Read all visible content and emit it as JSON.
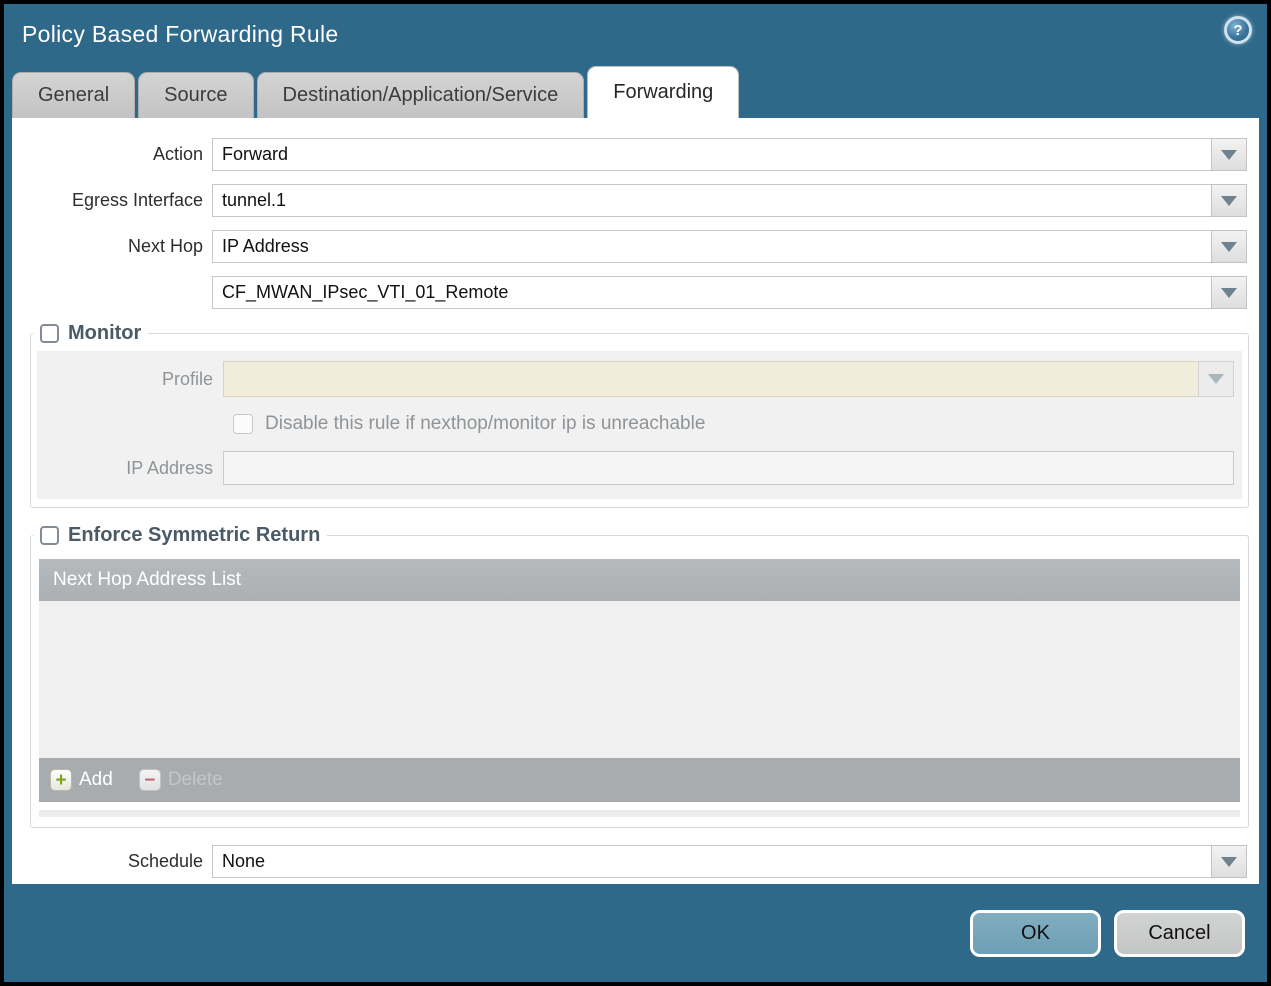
{
  "titlebar": {
    "title": "Policy Based Forwarding Rule"
  },
  "tabs": [
    {
      "label": "General",
      "active": false
    },
    {
      "label": "Source",
      "active": false
    },
    {
      "label": "Destination/Application/Service",
      "active": false
    },
    {
      "label": "Forwarding",
      "active": true
    }
  ],
  "form": {
    "action": {
      "label": "Action",
      "value": "Forward"
    },
    "egress_interface": {
      "label": "Egress Interface",
      "value": "tunnel.1"
    },
    "next_hop": {
      "label": "Next Hop",
      "value": "IP Address"
    },
    "next_hop_address": {
      "value": "CF_MWAN_IPsec_VTI_01_Remote"
    },
    "schedule": {
      "label": "Schedule",
      "value": "None"
    }
  },
  "monitor": {
    "title": "Monitor",
    "checked": false,
    "profile": {
      "label": "Profile",
      "value": ""
    },
    "disable_rule_label": "Disable this rule if nexthop/monitor ip is unreachable",
    "disable_rule_checked": false,
    "ip_address": {
      "label": "IP Address",
      "value": ""
    }
  },
  "enforce": {
    "title": "Enforce Symmetric Return",
    "checked": false,
    "table_header": "Next Hop Address List",
    "rows": [],
    "add_label": "Add",
    "delete_label": "Delete"
  },
  "help_icon": "?",
  "footer": {
    "ok_label": "OK",
    "cancel_label": "Cancel"
  },
  "colors": {
    "titlebar_bg": "#2F698A",
    "ok_button_bg": "#74A5BA",
    "cancel_button_bg": "#C9CACB",
    "profile_disabled_bg": "#F2ECDB",
    "table_header_bg": "#B1B4B6",
    "table_footer_bg": "#A9ACAE"
  }
}
